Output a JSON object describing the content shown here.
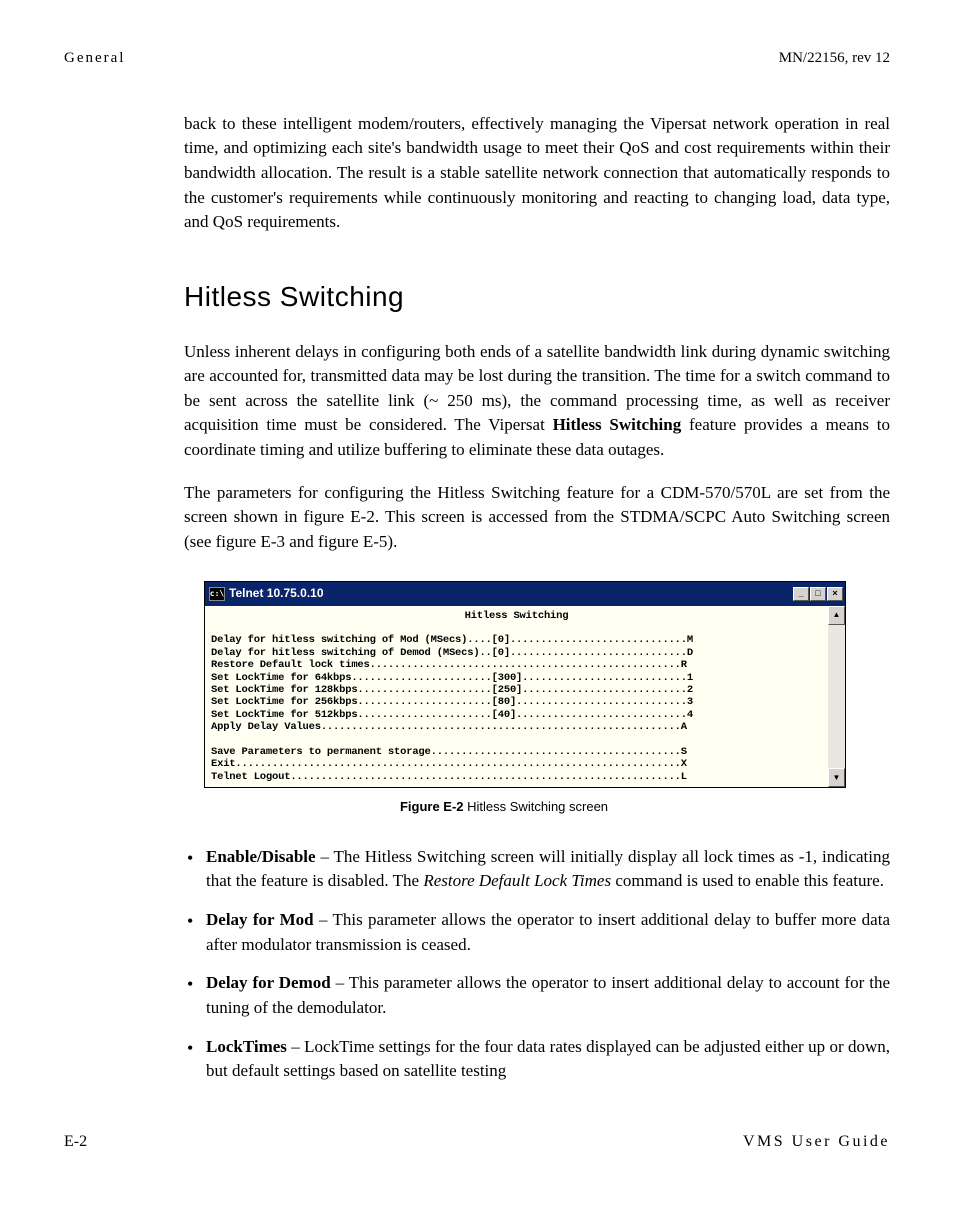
{
  "header": {
    "left": "General",
    "right": "MN/22156, rev 12"
  },
  "intro_para": "back to these intelligent modem/routers, effectively managing the Vipersat network operation in real time, and optimizing each site's bandwidth usage to meet their QoS and cost requirements within their bandwidth allocation. The result is a stable satellite network connection that automatically responds to the customer's requirements while continuously monitoring and reacting to changing load, data type, and QoS requirements.",
  "section_title": "Hitless Switching",
  "para1_a": "Unless inherent delays in configuring both ends of a satellite bandwidth link during dynamic switching are accounted for, transmitted data may be lost during the transition. The time for a switch command to be sent across the satellite link (~ 250 ms), the command processing time, as well as receiver acquisition time must be considered. The Vipersat ",
  "para1_bold": "Hitless Switching",
  "para1_b": " feature provides a means to coordinate timing and utilize buffering to eliminate these data outages.",
  "para2": "The parameters for configuring the Hitless Switching feature for a CDM-570/570L are set from the screen shown in figure E-2. This screen is accessed from the STDMA/SCPC Auto Switching screen (see figure E-3 and figure E-5).",
  "telnet": {
    "title": "Telnet 10.75.0.10",
    "controls": {
      "min": "_",
      "max": "□",
      "close": "×"
    },
    "scroll": {
      "up": "▲",
      "down": "▼"
    },
    "heading": "Hitless Switching",
    "lines": {
      "l1": "Delay for hitless switching of Mod (MSecs)....[0].............................M",
      "l2": "Delay for hitless switching of Demod (MSecs)..[0].............................D",
      "l3": "Restore Default lock times...................................................R",
      "l4": "Set LockTime for 64kbps.......................[300]...........................1",
      "l5": "Set LockTime for 128kbps......................[250]...........................2",
      "l6": "Set LockTime for 256kbps......................[80]............................3",
      "l7": "Set LockTime for 512kbps......................[40]............................4",
      "l8": "Apply Delay Values...........................................................A",
      "l9": "",
      "l10": "Save Parameters to permanent storage.........................................S",
      "l11": "Exit.........................................................................X",
      "l12": "Telnet Logout................................................................L"
    }
  },
  "figure_caption_bold": "Figure E-2",
  "figure_caption_rest": "  Hitless Switching screen",
  "bullets": {
    "b1_bold": "Enable/Disable",
    "b1_a": " – The Hitless Switching screen will initially display all lock times as -1, indicating that the feature is disabled. The ",
    "b1_italic": "Restore Default Lock Times",
    "b1_b": " command is used to enable this feature.",
    "b2_bold": "Delay for Mod",
    "b2_rest": " – This parameter allows the operator to insert additional delay to buffer more data after modulator transmission is ceased.",
    "b3_bold": "Delay for Demod",
    "b3_rest": " – This parameter allows the operator to insert additional delay to account for the tuning of the demodulator.",
    "b4_bold": "LockTimes",
    "b4_rest": " – LockTime settings for the four data rates displayed can be adjusted either up or down, but default settings based on satellite testing"
  },
  "footer": {
    "left": "E-2",
    "right": "VMS User Guide"
  }
}
